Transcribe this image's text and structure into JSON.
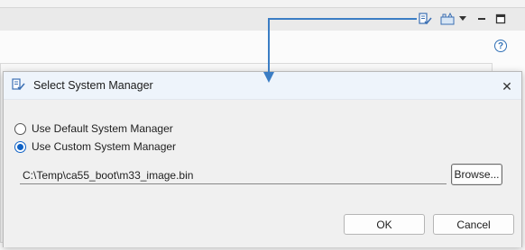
{
  "dialog": {
    "title": "Select System Manager",
    "options": [
      {
        "label": "Use Default System Manager",
        "selected": false
      },
      {
        "label": "Use Custom System Manager",
        "selected": true
      }
    ],
    "path_value": "C:\\Temp\\ca55_boot\\m33_image.bin",
    "browse_label": "Browse...",
    "ok_label": "OK",
    "cancel_label": "Cancel",
    "close_glyph": "✕"
  },
  "toolbar": {
    "icons": [
      "select-system-manager-icon",
      "system-manager-icon",
      "dropdown-arrow-icon",
      "minimize-icon",
      "maximize-icon"
    ],
    "help_glyph": "?"
  },
  "colors": {
    "accent": "#0f62c6",
    "arrow": "#3b7dc4",
    "title_bar": "#eef4fb"
  }
}
